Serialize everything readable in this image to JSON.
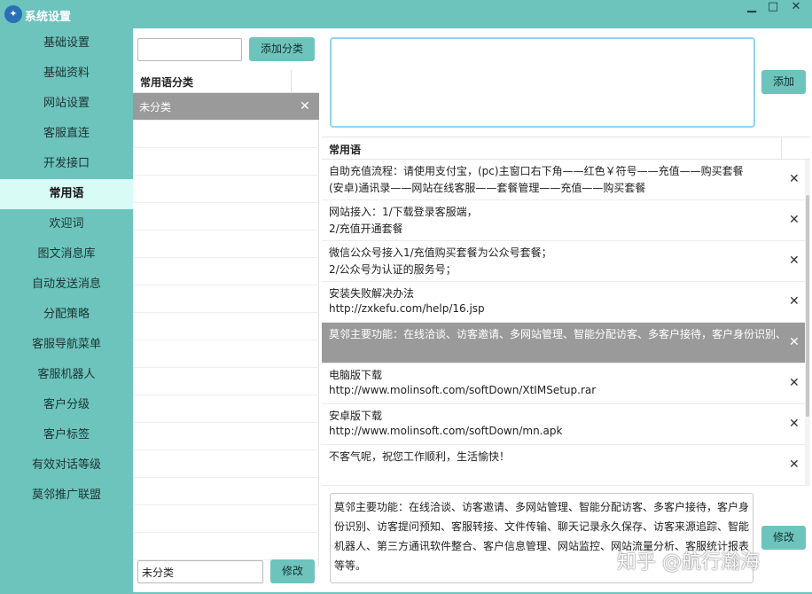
{
  "window": {
    "title": "系统设置",
    "icon": "bird-logo-icon",
    "controls": [
      "minimize-icon",
      "maximize-icon",
      "close-icon"
    ]
  },
  "sidebar": {
    "items": [
      {
        "label": "基础设置"
      },
      {
        "label": "基础资料"
      },
      {
        "label": "网站设置"
      },
      {
        "label": "客服直连"
      },
      {
        "label": "开发接口"
      },
      {
        "label": "常用语",
        "active": true
      },
      {
        "label": "欢迎词"
      },
      {
        "label": "图文消息库"
      },
      {
        "label": "自动发送消息"
      },
      {
        "label": "分配策略"
      },
      {
        "label": "客服导航菜单"
      },
      {
        "label": "客服机器人"
      },
      {
        "label": "客户分级"
      },
      {
        "label": "客户标签"
      },
      {
        "label": "有效对话等级"
      },
      {
        "label": "莫邻推广联盟"
      }
    ]
  },
  "category": {
    "add_input_value": "",
    "add_button": "添加分类",
    "header": "常用语分类",
    "rows": [
      {
        "label": "未分类",
        "selected": true
      }
    ],
    "edit_input_value": "未分类",
    "edit_button": "修改"
  },
  "phrases": {
    "new_phrase_value": "",
    "add_button": "添加",
    "header": "常用语",
    "rows": [
      {
        "line1": "自助充值流程：请使用支付宝，(pc)主窗口右下角——红色￥符号——充值——购买套餐",
        "line2": "(安卓)通讯录——网站在线客服——套餐管理——充值——购买套餐"
      },
      {
        "line1": "网站接入：1/下载登录客服端，",
        "line2": "2/充值开通套餐"
      },
      {
        "line1": "微信公众号接入1/充值购买套餐为公众号套餐；",
        "line2": "2/公众号为认证的服务号；"
      },
      {
        "line1": "安装失败解决办法",
        "line2": "http://zxkefu.com/help/16.jsp"
      },
      {
        "line1": "莫邻主要功能：在线洽谈、访客邀请、多网站管理、智能分配访客、多客户接待，客户身份识别、",
        "line2": "",
        "selected": true
      },
      {
        "line1": "电脑版下载",
        "line2": "http://www.molinsoft.com/softDown/XtIMSetup.rar"
      },
      {
        "line1": "安卓版下载",
        "line2": "http://www.molinsoft.com/softDown/mn.apk"
      },
      {
        "line1": "不客气呢，祝您工作顺利，生活愉快！",
        "line2": ""
      }
    ],
    "edit_text": "莫邻主要功能：在线洽谈、访客邀请、多网站管理、智能分配访客、多客户接待，客户身份识别、访客提问预知、客服转接、文件传输、聊天记录永久保存、访客来源追踪、智能机器人、第三方通讯软件整合、客户信息管理、网站监控、网站流量分析、客服统计报表等等。",
    "edit_button": "修改"
  },
  "watermark": "知乎 @航行瀚海",
  "colors": {
    "accent": "#6cc4bd",
    "active_nav": "#d8fbf6",
    "selected_row": "#9a9a9a"
  }
}
